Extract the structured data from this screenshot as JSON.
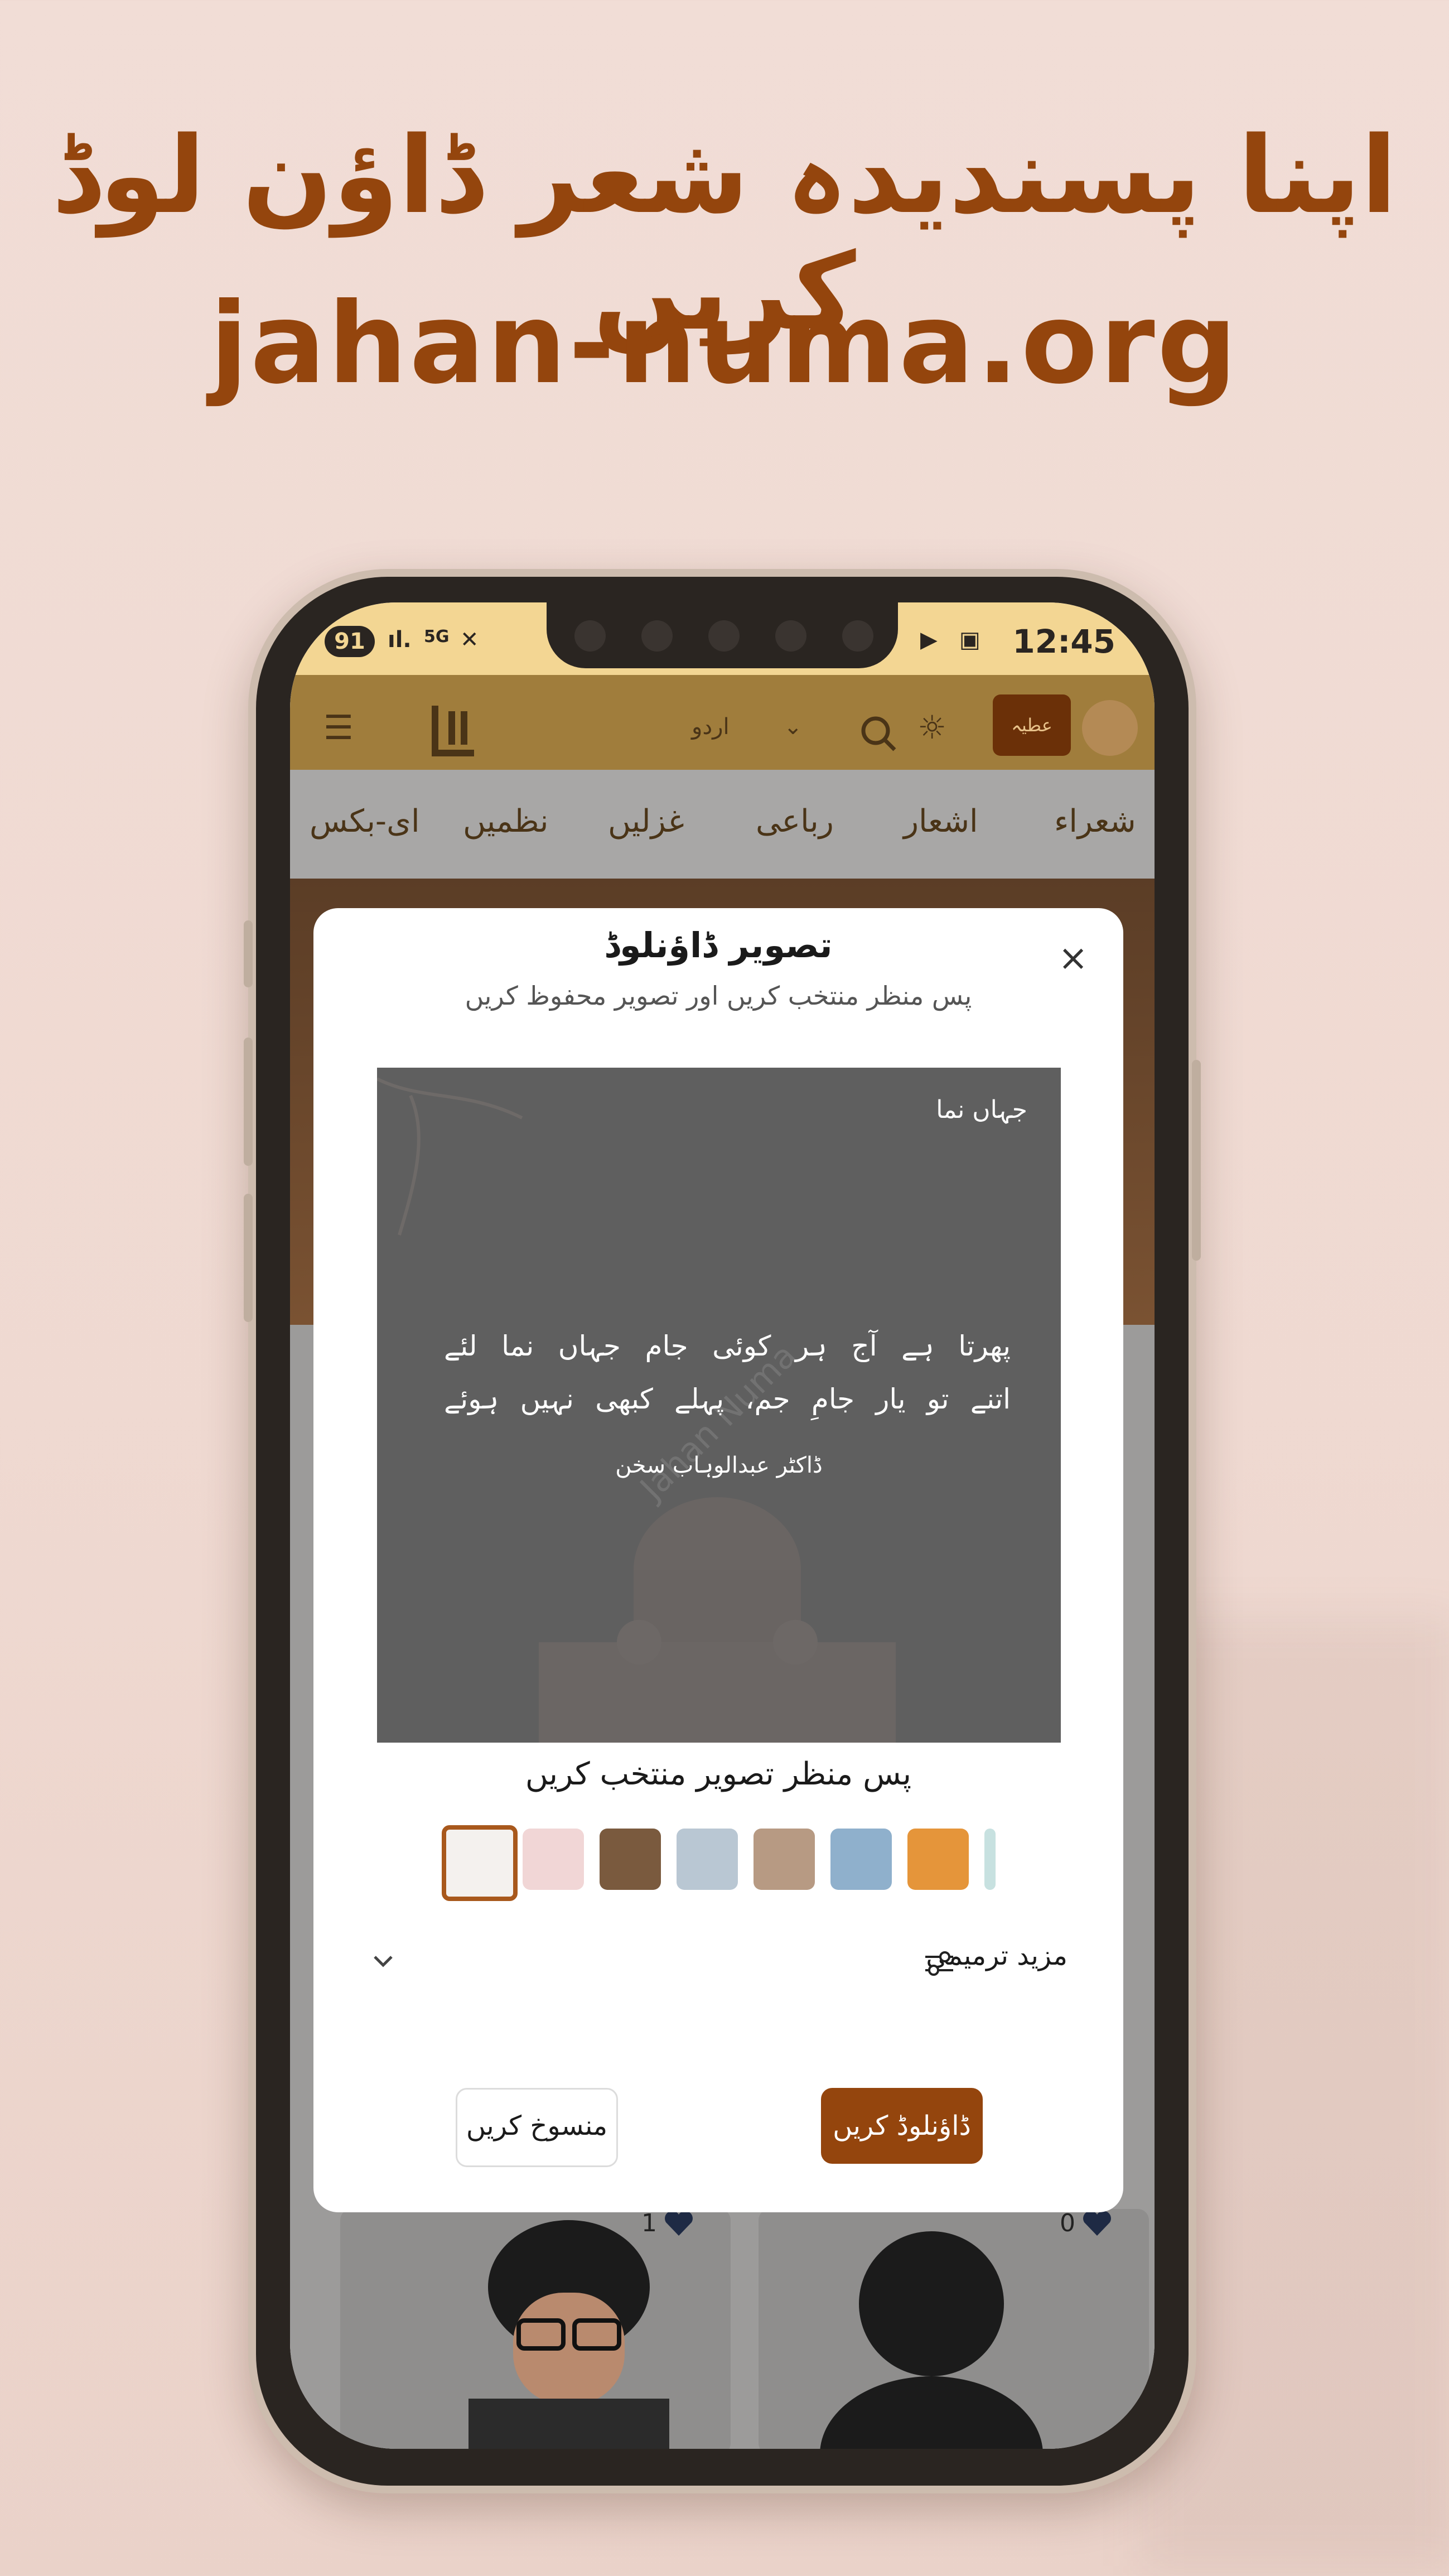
{
  "promo": {
    "headline": "اپنا پسندیدہ شعر ڈاؤن لوڈ کریں",
    "url": "jahan-numa.org"
  },
  "status_bar": {
    "battery": "91",
    "network": "5G",
    "time": "12:45"
  },
  "header": {
    "language": "اردو",
    "donate_label": "عطیہ"
  },
  "nav": {
    "items": [
      "شعراء",
      "اشعار",
      "رباعی",
      "غزلیں",
      "نظمیں",
      "ای-بکس"
    ]
  },
  "modal": {
    "title": "تصویر ڈاؤنلوڈ",
    "subtitle": "پس منظر منتخب کریں اور تصویر محفوظ کریں",
    "preview": {
      "brand": "جہاں نما",
      "verse_line_1": "پھرتا ہے آج ہر کوئی جام جہاں نما لئے",
      "verse_line_2": "اتنے تو یار جامِ جم، پہلے کبھی نہیں ہوئے",
      "poet": "ڈاکٹر عبدالوہاب سخن",
      "watermark": "Jahan Numa"
    },
    "choose_background_label": "پس منظر تصویر منتخب کریں",
    "thumbnails": [
      {
        "name": "white-dome",
        "color": "#f4f1ee"
      },
      {
        "name": "pink-flowers",
        "color": "#f1d6d6"
      },
      {
        "name": "brown-pen",
        "color": "#7a5a3e"
      },
      {
        "name": "blue-clouds",
        "color": "#b9c7d3"
      },
      {
        "name": "brown-room",
        "color": "#b79a83"
      },
      {
        "name": "blue-sky",
        "color": "#8fb0cc"
      },
      {
        "name": "orange-sunset",
        "color": "#e5953a"
      },
      {
        "name": "teal",
        "color": "#c7e1e0"
      }
    ],
    "more_options_label": "مزید ترمیمی",
    "download_button": "ڈاؤنلوڈ کریں",
    "cancel_button": "منسوخ کریں"
  },
  "cards": [
    {
      "like_count": "1"
    },
    {
      "like_count": "0"
    }
  ],
  "colors": {
    "accent": "#94450d",
    "status_bar": "#f3d693",
    "background": "#efdad2"
  }
}
